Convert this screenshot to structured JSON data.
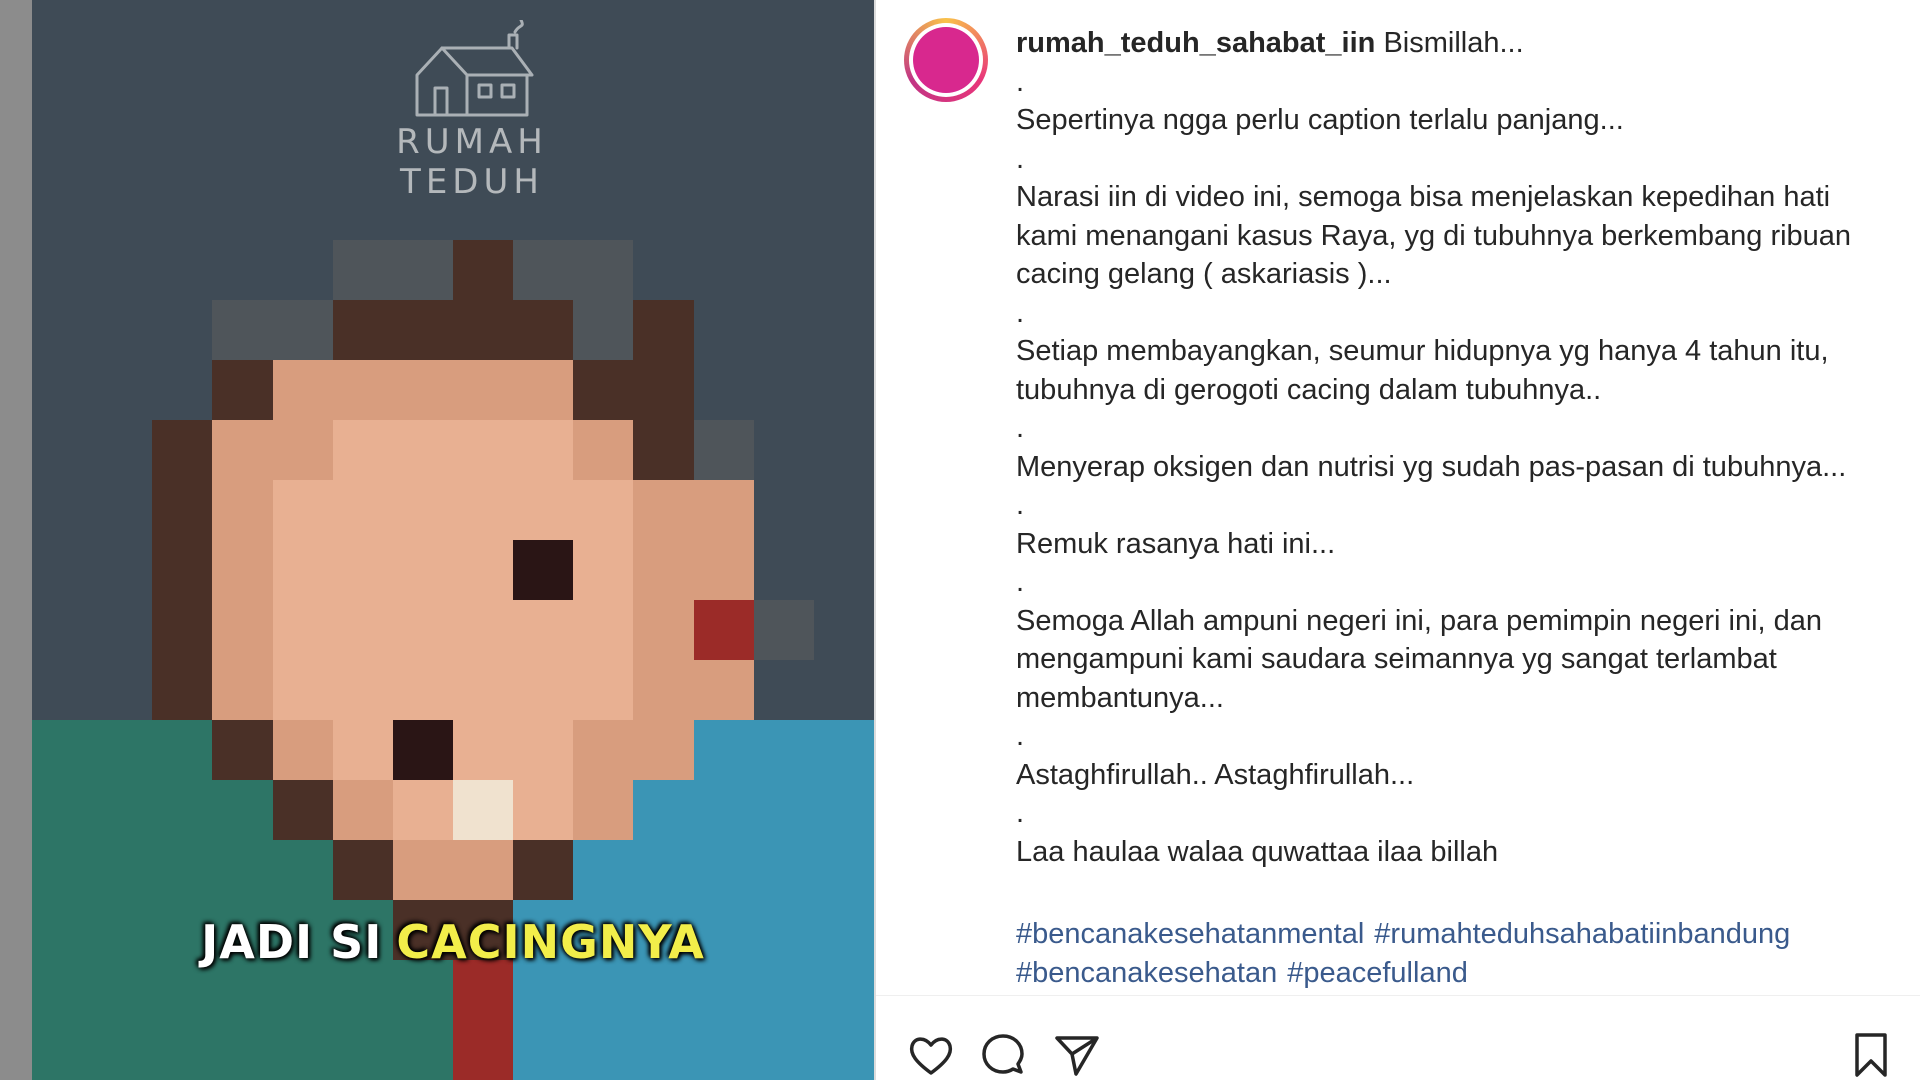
{
  "media": {
    "watermark_text": "RUMAH TEDUH",
    "subtitle_word1": "JADI SI",
    "subtitle_word2": "CACINGNYA"
  },
  "post": {
    "username": "rumah_teduh_sahabat_iin",
    "first_line": "Bismillah...",
    "caption_lines": [
      ".",
      "Sepertinya ngga perlu caption terlalu panjang...",
      ".",
      "Narasi iin di video ini, semoga bisa menjelaskan kepedihan hati",
      "kami menangani kasus Raya, yg di tubuhnya berkembang ribuan",
      "cacing gelang ( askariasis )...",
      ".",
      "Setiap membayangkan, seumur hidupnya yg hanya 4 tahun itu,",
      "tubuhnya di gerogoti cacing dalam tubuhnya..",
      ".",
      "Menyerap oksigen dan nutrisi yg sudah pas-pasan di tubuhnya...",
      ".",
      "Remuk rasanya hati ini...",
      ".",
      "Semoga Allah ampuni negeri ini, para pemimpin negeri ini, dan",
      "mengampuni kami saudara seimannya yg sangat terlambat",
      "membantunya...",
      ".",
      "Astaghfirullah.. Astaghfirullah...",
      ".",
      "Laa haulaa walaa quwattaa ilaa billah"
    ],
    "hashtags": [
      "#bencanakesehatanmental",
      "#rumahteduhsahabatiinbandung",
      "#bencanakesehatan",
      "#peacefulland"
    ]
  },
  "actions": {
    "like_icon": "heart-icon",
    "comment_icon": "comment-icon",
    "share_icon": "paper-plane-icon",
    "save_icon": "bookmark-icon"
  },
  "colors": {
    "hashtag": "#3a5a8c",
    "subtitle_highlight": "#f2ee4a",
    "text": "#262626"
  }
}
